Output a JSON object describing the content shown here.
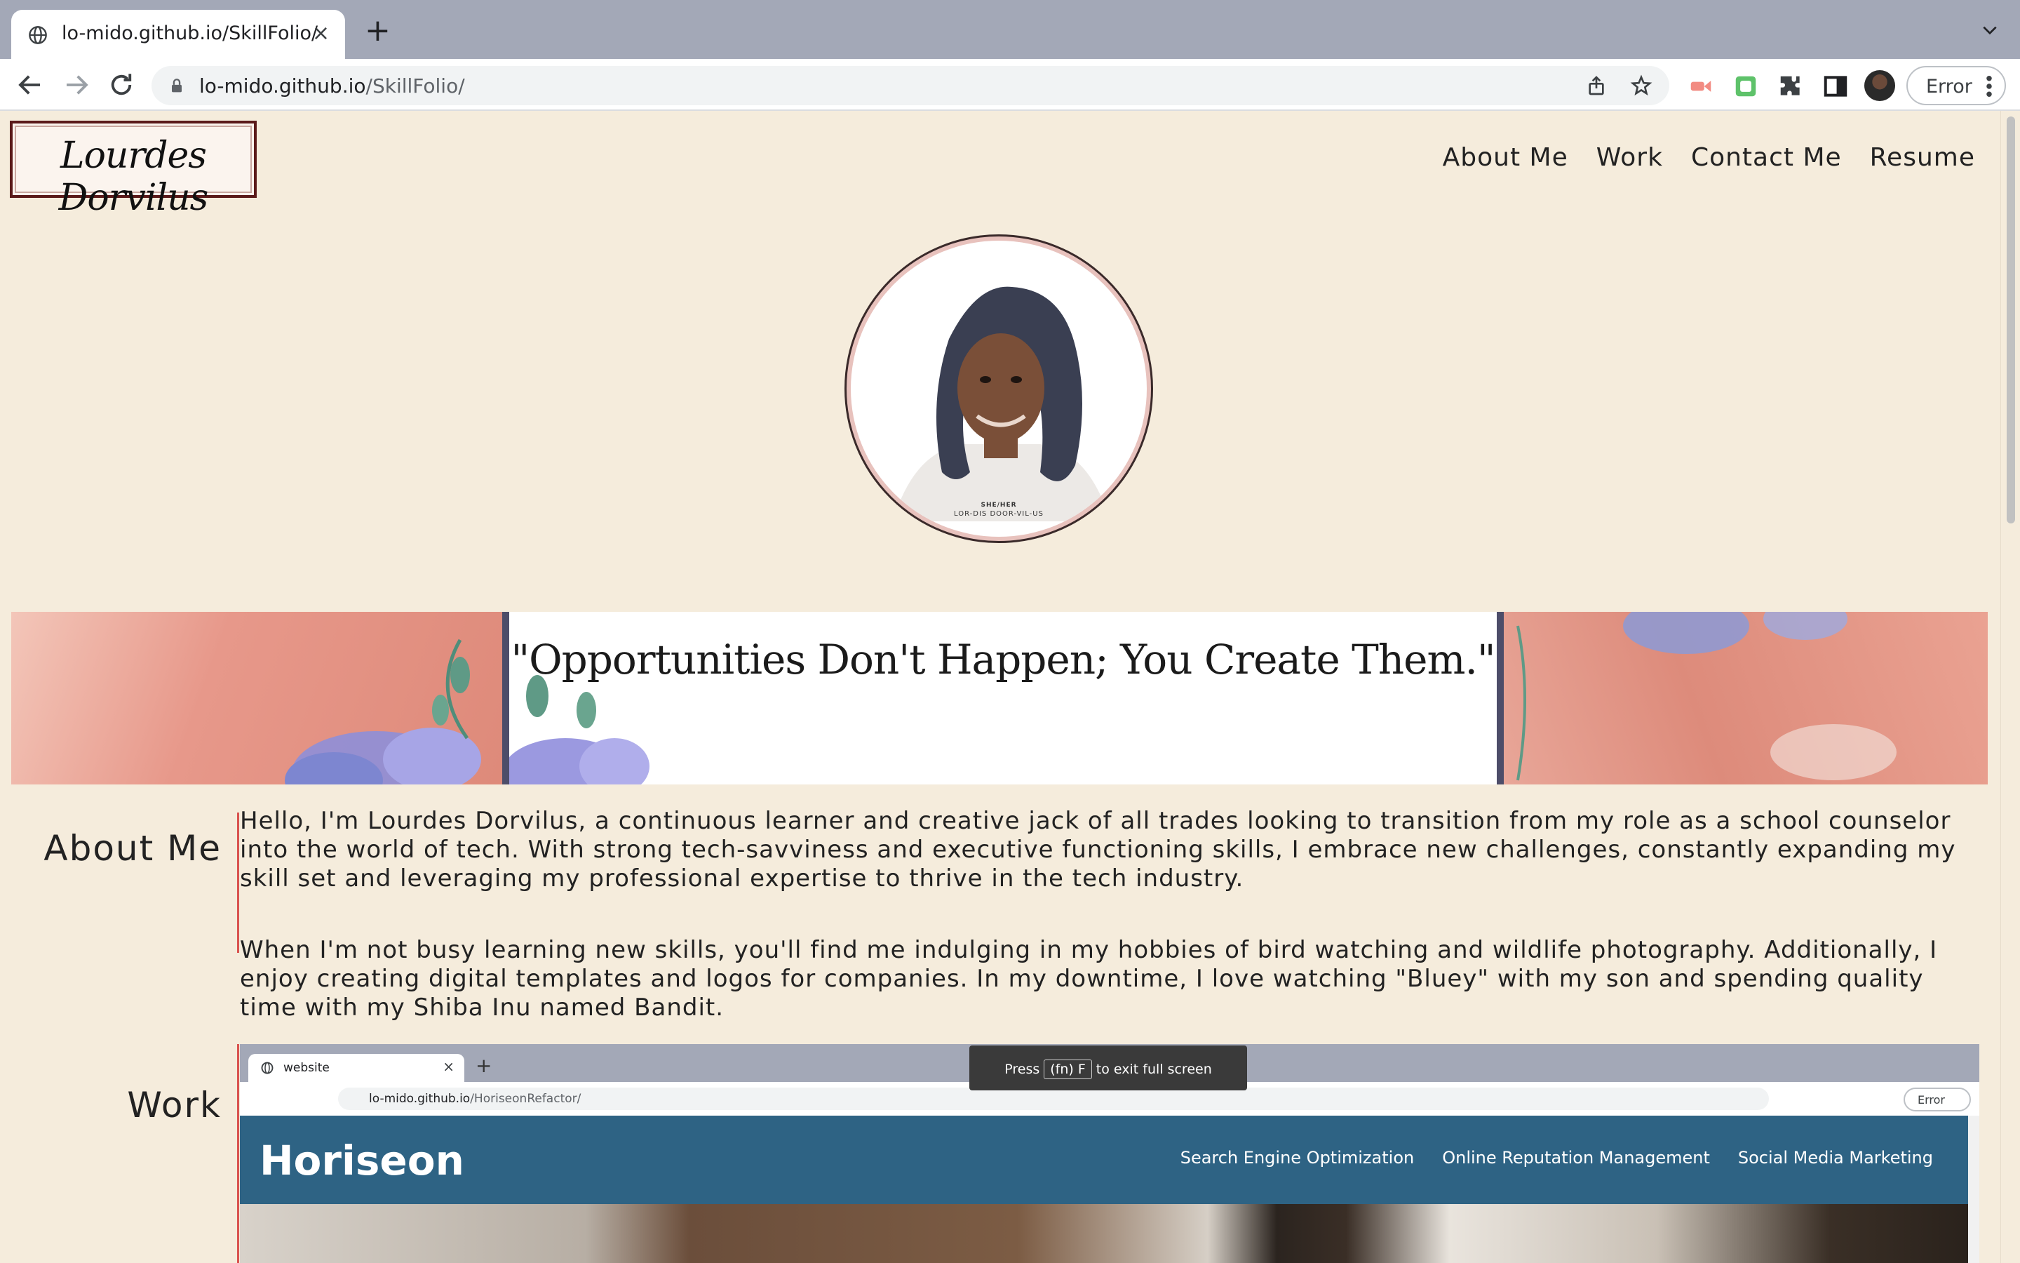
{
  "browser": {
    "tab_title": "lo-mido.github.io/SkillFolio/",
    "tab_close": "×",
    "new_tab": "+",
    "url_host": "lo-mido.github.io",
    "url_path": "/SkillFolio/",
    "profile_button": "Error"
  },
  "site": {
    "logo_text": "Lourdes Dorvilus",
    "nav": [
      "About Me",
      "Work",
      "Contact Me",
      "Resume"
    ],
    "avatar_caption_line1": "SHE/HER",
    "avatar_caption_line2": "LOR-DIS DOOR-VIL-US",
    "banner_quote": "\"Opportunities Don't Happen; You Create Them.\"",
    "about": {
      "title": "About Me",
      "paragraph1": "Hello, I'm Lourdes Dorvilus, a continuous learner and creative jack of all trades looking to transition from my role as a school counselor into the world of tech. With strong tech-savviness and executive functioning skills, I embrace new challenges, constantly expanding my skill set and leveraging my professional expertise to thrive in the tech industry.",
      "paragraph2": "When I'm not busy learning new skills, you'll find me indulging in my hobbies of bird watching and wildlife photography. Additionally, I enjoy creating digital templates and logos for companies. In my downtime, I love watching \"Bluey\" with my son and spending quality time with my Shiba Inu named Bandit."
    },
    "work": {
      "title": "Work",
      "screenshot": {
        "tab_title": "website",
        "url_host": "lo-mido.github.io",
        "url_path": "/HoriseonRefactor/",
        "fullscreen_press": "Press",
        "fullscreen_key": "(fn) F",
        "fullscreen_suffix": "to exit full screen",
        "error_label": "Error",
        "brand": "Horiseon",
        "nav": [
          "Search Engine Optimization",
          "Online Reputation Management",
          "Social Media Marketing"
        ]
      }
    }
  },
  "colors": {
    "page_bg": "#f5ecdc",
    "accent_line": "#d9534f",
    "banner_card_border": "#4d4d69",
    "horiseon_header": "#2e6384"
  }
}
